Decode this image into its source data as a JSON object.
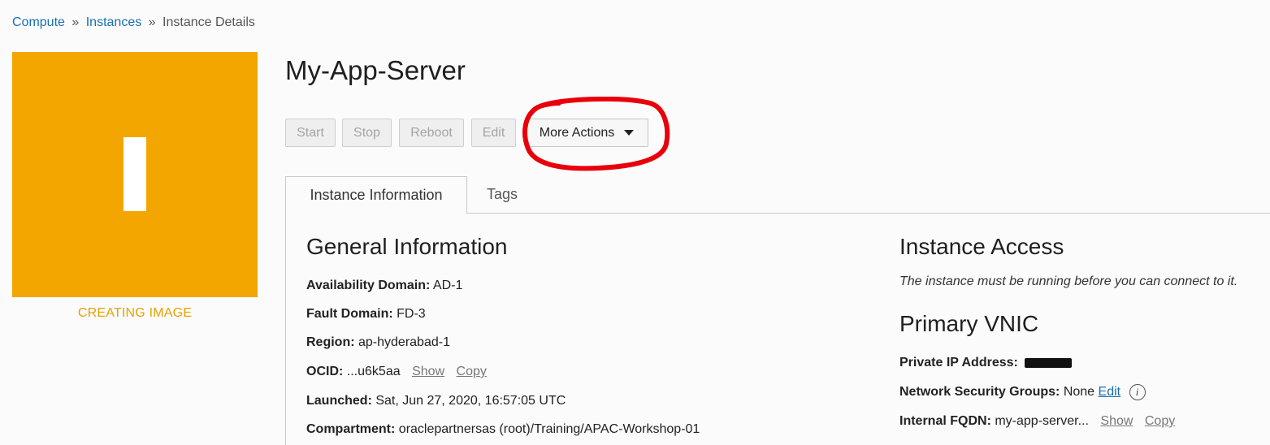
{
  "breadcrumb": {
    "compute": "Compute",
    "instances": "Instances",
    "current": "Instance Details",
    "separator": "»"
  },
  "status": {
    "glyph": "instance-icon",
    "label": "CREATING IMAGE",
    "color": "#f4a600"
  },
  "title": "My-App-Server",
  "actions": {
    "start": "Start",
    "stop": "Stop",
    "reboot": "Reboot",
    "edit": "Edit",
    "more": "More Actions"
  },
  "tabs": {
    "instance_information": "Instance Information",
    "tags": "Tags"
  },
  "general": {
    "title": "General Information",
    "availability_domain": {
      "label": "Availability Domain:",
      "value": "AD-1"
    },
    "fault_domain": {
      "label": "Fault Domain:",
      "value": "FD-3"
    },
    "region": {
      "label": "Region:",
      "value": "ap-hyderabad-1"
    },
    "ocid": {
      "label": "OCID:",
      "value": "...u6k5aa",
      "show": "Show",
      "copy": "Copy"
    },
    "launched": {
      "label": "Launched:",
      "value": "Sat, Jun 27, 2020, 16:57:05 UTC"
    },
    "compartment": {
      "label": "Compartment:",
      "value": "oraclepartnersas (root)/Training/APAC-Workshop-01"
    }
  },
  "access": {
    "title": "Instance Access",
    "note": "The instance must be running before you can connect to it."
  },
  "vnic": {
    "title": "Primary VNIC",
    "private_ip": {
      "label": "Private IP Address:"
    },
    "nsg": {
      "label": "Network Security Groups:",
      "value": "None",
      "edit": "Edit"
    },
    "fqdn": {
      "label": "Internal FQDN:",
      "value": "my-app-server...",
      "show": "Show",
      "copy": "Copy"
    }
  },
  "colors": {
    "accent_link": "#1a6fb0",
    "status_orange": "#f4a600",
    "annotation_red": "#e8000b"
  }
}
